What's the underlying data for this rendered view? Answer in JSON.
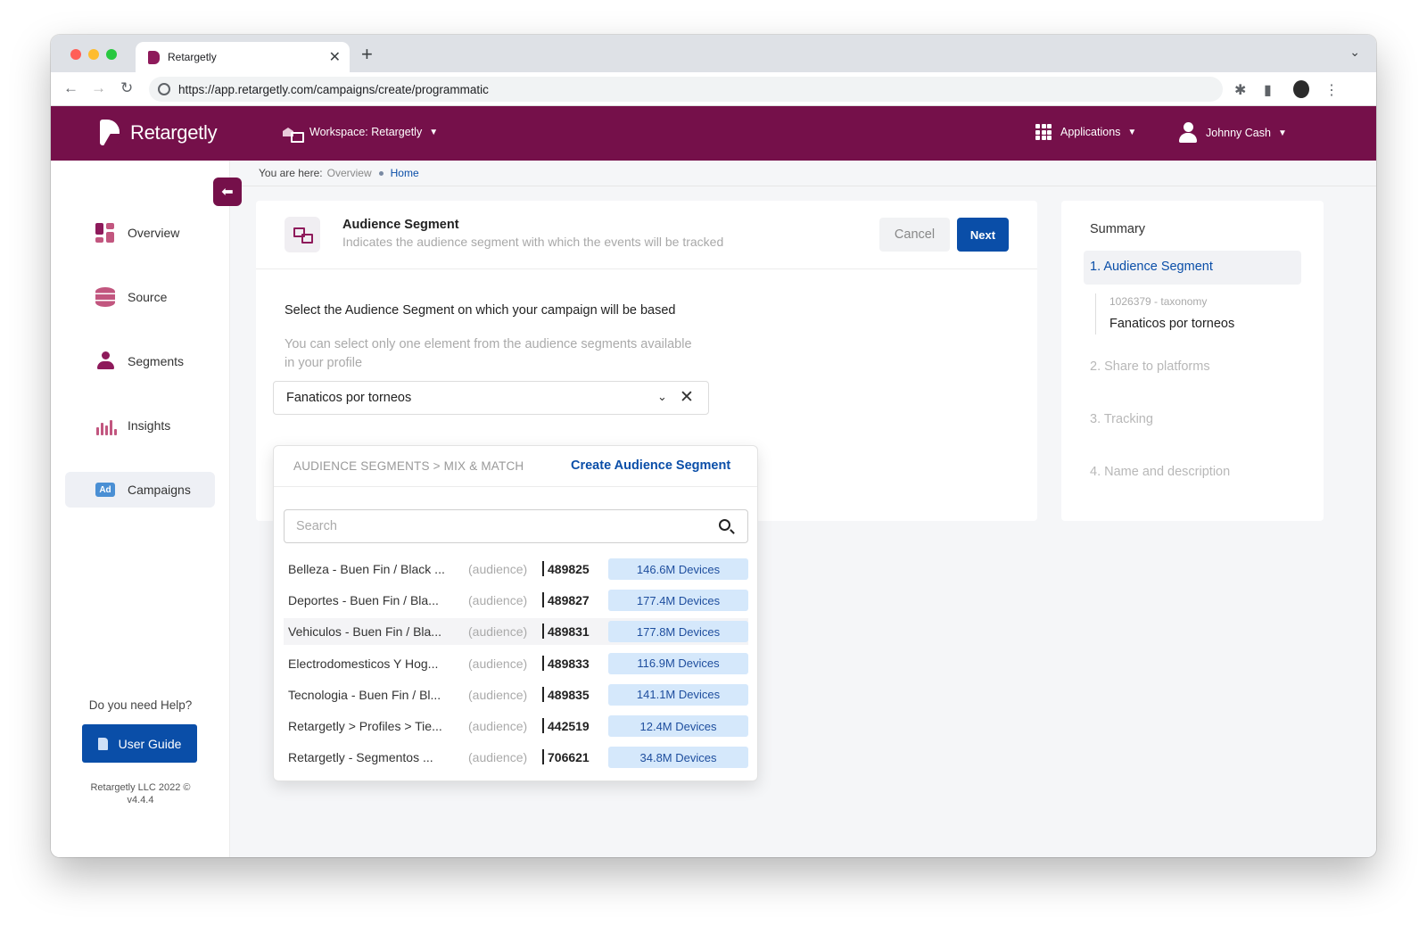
{
  "browser": {
    "tab_title": "Retargetly",
    "url": "https://app.retargetly.com/campaigns/create/programmatic"
  },
  "header": {
    "logo": "Retargetly",
    "workspace": "Workspace: Retargetly",
    "applications": "Applications",
    "user": "Johnny Cash"
  },
  "sidebar": {
    "items": [
      {
        "label": "Overview",
        "icon": "overview-icon"
      },
      {
        "label": "Source",
        "icon": "database-icon"
      },
      {
        "label": "Segments",
        "icon": "users-icon"
      },
      {
        "label": "Insights",
        "icon": "chart-icon"
      },
      {
        "label": "Campaigns",
        "icon": "ad-icon",
        "active": true
      }
    ],
    "help": "Do you need Help?",
    "guide": "User Guide",
    "copyright": "Retargetly LLC 2022 ©",
    "version": "v4.4.4"
  },
  "breadcrumb": {
    "prefix": "You are here:",
    "overview": "Overview",
    "home": "Home"
  },
  "card": {
    "title": "Audience Segment",
    "subtitle": "Indicates the audience segment with which the events will be tracked",
    "cancel": "Cancel",
    "next": "Next",
    "question": "Select the Audience Segment on which your campaign will be based",
    "hint": "You can select only one element from the audience segments available in your profile",
    "selected": "Fanaticos por torneos"
  },
  "dropdown": {
    "crumb": "AUDIENCE SEGMENTS > MIX & MATCH",
    "create": "Create Audience Segment",
    "search_placeholder": "Search",
    "rows": [
      {
        "name": "Belleza - Buen Fin / Black Friday",
        "display": "Belleza - Buen Fin / Black ...",
        "type": "(audience)",
        "id": "489825",
        "devices": "146.6M Devices"
      },
      {
        "name": "Deportes - Buen Fin / Black Friday",
        "display": "Deportes - Buen Fin / Bla...",
        "type": "(audience)",
        "id": "489827",
        "devices": "177.4M Devices"
      },
      {
        "name": "Vehiculos - Buen Fin / Black Friday",
        "display": "Vehiculos - Buen Fin / Bla...",
        "type": "(audience)",
        "id": "489831",
        "devices": "177.8M Devices"
      },
      {
        "name": "Electrodomesticos Y Hogar",
        "display": "Electrodomesticos Y Hog...",
        "type": "(audience)",
        "id": "489833",
        "devices": "116.9M Devices"
      },
      {
        "name": "Tecnologia - Buen Fin / Black Friday",
        "display": "Tecnologia - Buen Fin / Bl...",
        "type": "(audience)",
        "id": "489835",
        "devices": "141.1M Devices"
      },
      {
        "name": "Retargetly > Profiles > Tier",
        "display": "Retargetly > Profiles > Tie...",
        "type": "(audience)",
        "id": "442519",
        "devices": "12.4M Devices"
      },
      {
        "name": "Retargetly - Segmentos",
        "display": "Retargetly - Segmentos ...",
        "type": "(audience)",
        "id": "706621",
        "devices": "34.8M Devices"
      }
    ]
  },
  "summary": {
    "title": "Summary",
    "step1": "1. Audience Segment",
    "meta": "1026379 - taxonomy",
    "selected": "Fanaticos por torneos",
    "step2": "2. Share to platforms",
    "step3": "3. Tracking",
    "step4": "4. Name and description"
  },
  "colors": {
    "brand": "#75104a",
    "primary": "#0a4ea8",
    "devices_badge": "#d5e8fb"
  }
}
